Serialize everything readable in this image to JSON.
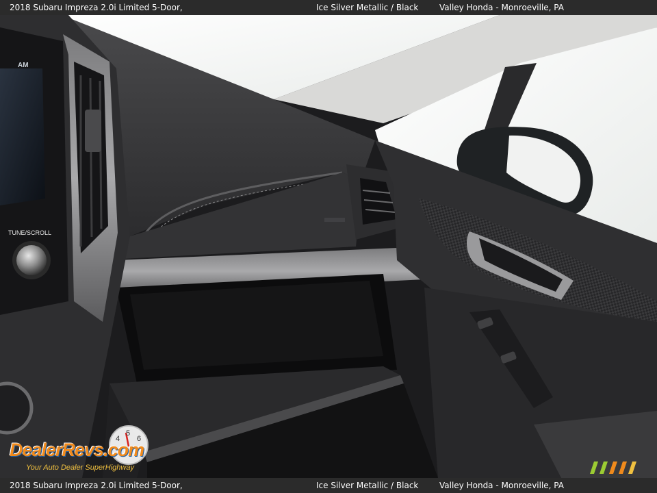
{
  "caption": {
    "vehicle": "2018 Subaru Impreza 2.0i Limited 5-Door,",
    "colors": "Ice Silver Metallic  /  Black",
    "dealer": "Valley Honda - Monroeville, PA"
  },
  "dashboard_labels": {
    "radio_band": "AM",
    "tune_knob": "TUNE/SCROLL"
  },
  "watermark": {
    "brand": "DealerRevs.com",
    "tagline": "Your Auto Dealer SuperHighway",
    "gauge_digits": [
      "4",
      "5",
      "6"
    ]
  },
  "palette": {
    "dash_dark": "#3b3b3d",
    "trim_silver": "#8e8e90",
    "window_sky": "#f4f5f4",
    "brand_blue": "#1f5fa6",
    "brand_orange": "#f08a1c",
    "brand_green": "#9ccc33"
  }
}
